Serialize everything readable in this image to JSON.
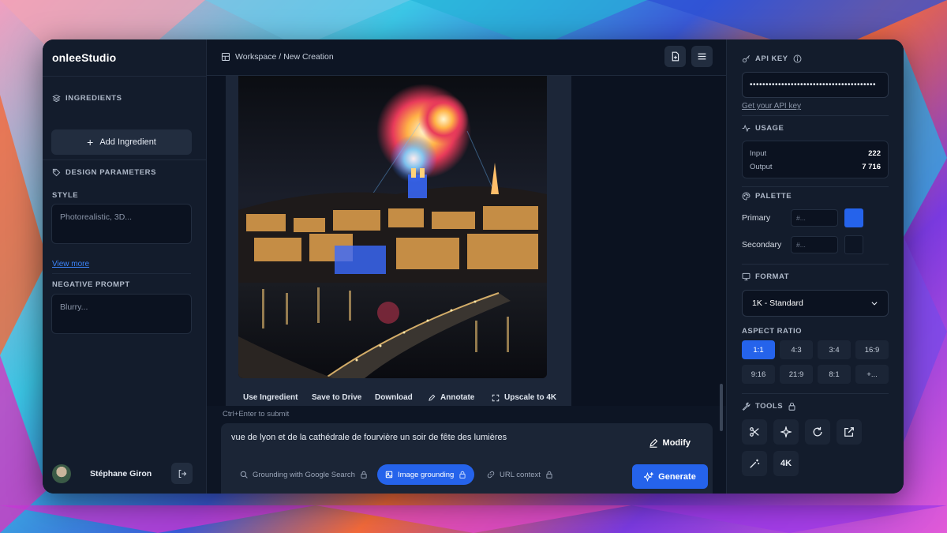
{
  "app": {
    "logo_prefix": "onlee",
    "logo_suffix": "Studio"
  },
  "sidebar": {
    "ingredients_title": "INGREDIENTS",
    "add_ingredient_label": "Add Ingredient",
    "design_parameters_title": "DESIGN PARAMETERS",
    "style_label": "STYLE",
    "style_placeholder": "Photorealistic, 3D...",
    "view_more_label": "View more",
    "negative_prompt_label": "NEGATIVE PROMPT",
    "negative_prompt_placeholder": "Blurry...",
    "user_name": "Stéphane Giron"
  },
  "header": {
    "breadcrumb": "Workspace / New Creation"
  },
  "image_actions": {
    "use_ingredient": "Use Ingredient",
    "save_to_drive": "Save to Drive",
    "download": "Download",
    "annotate": "Annotate",
    "upscale": "Upscale to 4K"
  },
  "prompt": {
    "hint": "Ctrl+Enter to submit",
    "text": "vue de lyon et de la cathédrale de fourvière un soir de fête des lumières",
    "modify_label": "Modify",
    "grounding_google": "Grounding with Google Search",
    "image_grounding": "Image grounding",
    "url_context": "URL context",
    "generate_label": "Generate"
  },
  "right_panel": {
    "api_key_title": "API KEY",
    "api_key_value": "••••••••••••••••••••••••••••••••••••••••",
    "get_api_key_label": "Get your API key",
    "usage_title": "USAGE",
    "usage": [
      {
        "label": "Input",
        "value": "222"
      },
      {
        "label": "Output",
        "value": "7 716"
      }
    ],
    "palette_title": "PALETTE",
    "primary_label": "Primary",
    "primary_placeholder": "#...",
    "primary_color": "#2563eb",
    "secondary_label": "Secondary",
    "secondary_placeholder": "#...",
    "secondary_color": "#0d1524",
    "format_title": "FORMAT",
    "format_value": "1K - Standard",
    "aspect_ratio_title": "ASPECT RATIO",
    "aspect_ratios": [
      "1:1",
      "4:3",
      "3:4",
      "16:9",
      "9:16",
      "21:9",
      "8:1",
      "+..."
    ],
    "aspect_ratio_selected": "1:1",
    "tools_title": "TOOLS",
    "tools": [
      "scissors-icon",
      "sparkle-icon",
      "refresh-icon",
      "export-icon",
      "magic-wand-icon",
      "4K"
    ]
  },
  "colors": {
    "accent": "#2563eb",
    "panel": "#131c2c",
    "background": "#0d1524"
  }
}
